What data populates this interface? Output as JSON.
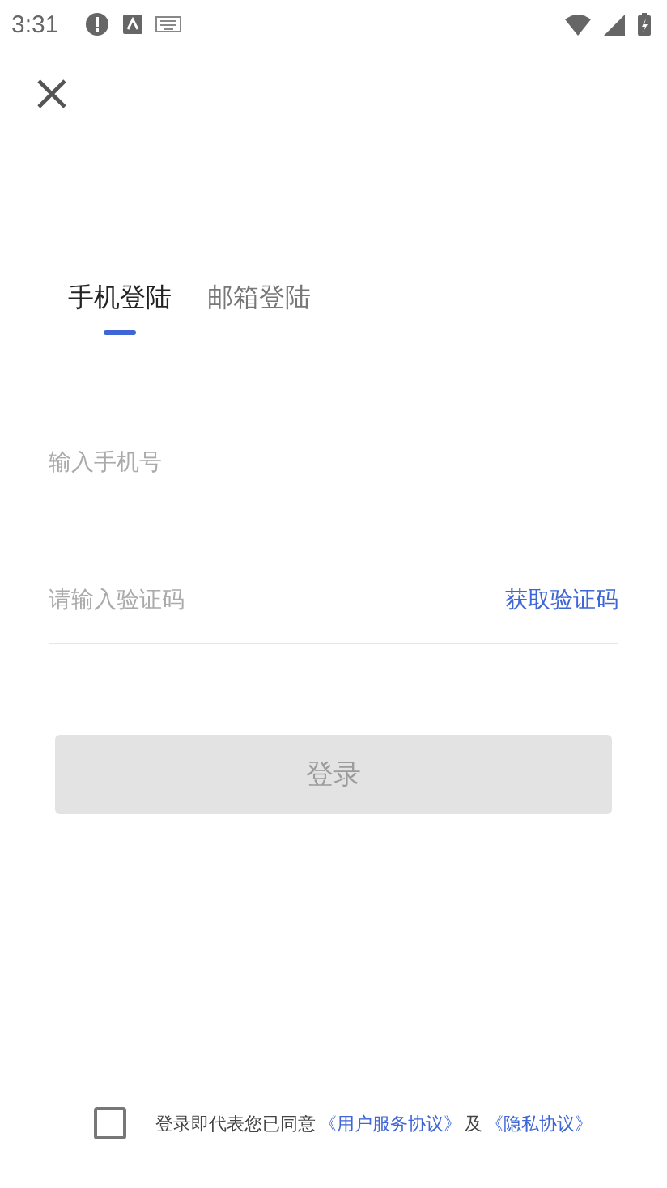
{
  "status_bar": {
    "time": "3:31"
  },
  "tabs": [
    {
      "label": "手机登陆",
      "selected": true
    },
    {
      "label": "邮箱登陆",
      "selected": false
    }
  ],
  "phone_field": {
    "placeholder": "输入手机号"
  },
  "code_field": {
    "placeholder": "请输入验证码"
  },
  "get_code_link": "获取验证码",
  "login_button": {
    "label": "登录",
    "disabled": true
  },
  "agreement": {
    "checked": false,
    "text": "登录即代表您已同意",
    "terms_link": "《用户服务协议》",
    "conjunction": "及",
    "privacy_link": "《隐私协议》"
  }
}
